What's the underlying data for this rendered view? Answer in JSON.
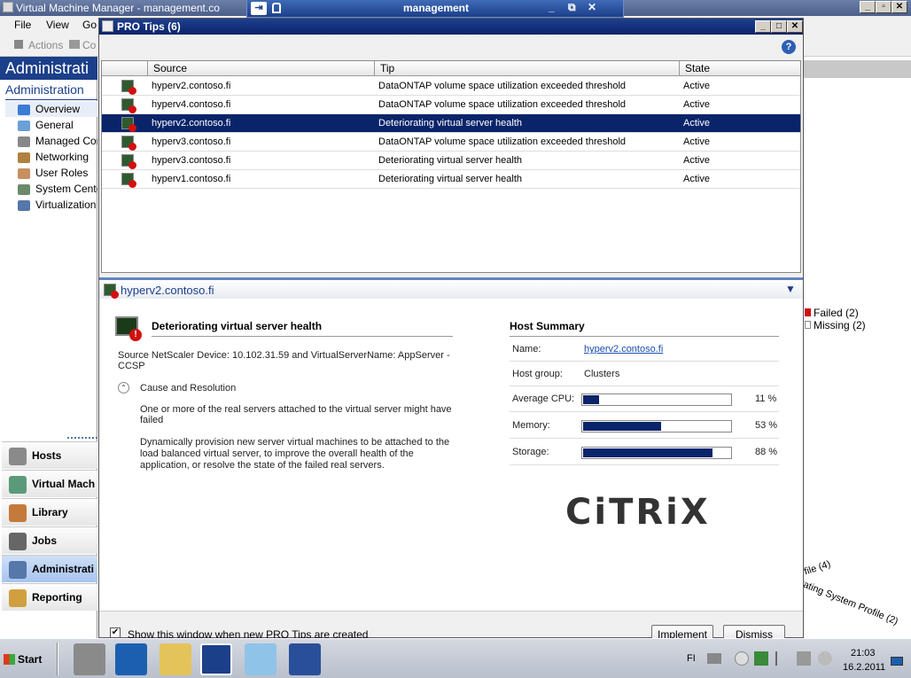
{
  "vmm": {
    "title": "Virtual Machine Manager - management.co",
    "menu": [
      "File",
      "View",
      "Go"
    ],
    "toolbar": {
      "actions": "Actions",
      "columns": "Co"
    },
    "left_header": "Administrati",
    "sub_title": "Administration",
    "tree": [
      {
        "label": "Overview",
        "icon": "overview-icon",
        "color": "#3a7bd5"
      },
      {
        "label": "General",
        "icon": "general-icon",
        "color": "#6a9fd8"
      },
      {
        "label": "Managed Cor",
        "icon": "managed-computers-icon",
        "color": "#888"
      },
      {
        "label": "Networking",
        "icon": "networking-icon",
        "color": "#b08040"
      },
      {
        "label": "User Roles",
        "icon": "user-roles-icon",
        "color": "#c89060"
      },
      {
        "label": "System Cente",
        "icon": "system-center-icon",
        "color": "#6a8a6a"
      },
      {
        "label": "Virtualization I",
        "icon": "virtualization-icon",
        "color": "#5577aa"
      }
    ],
    "nav": [
      {
        "label": "Hosts",
        "icon": "hosts-icon",
        "color": "#8a8a8a"
      },
      {
        "label": "Virtual Mach",
        "icon": "virtual-machines-icon",
        "color": "#5a9a7a"
      },
      {
        "label": "Library",
        "icon": "library-icon",
        "color": "#c47a3a"
      },
      {
        "label": "Jobs",
        "icon": "jobs-icon",
        "color": "#666"
      },
      {
        "label": "Administrati",
        "icon": "administration-icon",
        "color": "#5577aa"
      },
      {
        "label": "Reporting",
        "icon": "reporting-icon",
        "color": "#d0a040"
      }
    ],
    "right": {
      "failed": "Failed (2)",
      "missing": "Missing (2)",
      "os_profile": "erating System Profile (2)",
      "os_profile2": "file (4)"
    }
  },
  "remote_bar": {
    "title": "management"
  },
  "pro_tips": {
    "title": "PRO Tips (6)",
    "columns": [
      "Source",
      "Tip",
      "State"
    ],
    "rows": [
      {
        "source": "hyperv2.contoso.fi",
        "tip": "DataONTAP volume space utilization exceeded threshold",
        "state": "Active"
      },
      {
        "source": "hyperv4.contoso.fi",
        "tip": "DataONTAP volume space utilization exceeded threshold",
        "state": "Active"
      },
      {
        "source": "hyperv2.contoso.fi",
        "tip": "Deteriorating virtual server health",
        "state": "Active"
      },
      {
        "source": "hyperv3.contoso.fi",
        "tip": "DataONTAP volume space utilization exceeded threshold",
        "state": "Active"
      },
      {
        "source": "hyperv3.contoso.fi",
        "tip": "Deteriorating virtual server health",
        "state": "Active"
      },
      {
        "source": "hyperv1.contoso.fi",
        "tip": "Deteriorating virtual server health",
        "state": "Active"
      }
    ],
    "detail": {
      "host": "hyperv2.contoso.fi",
      "heading": "Deteriorating virtual server health",
      "source_line1": "Source NetScaler Device: 10.102.31.59 and VirtualServerName: AppServer -",
      "source_line2": "CCSP",
      "cause_label": "Cause and Resolution",
      "cause_text1": "One or more of the real servers attached to the virtual server might have",
      "cause_text2": "failed",
      "resolution1": "Dynamically provision new server virtual machines to be attached to the",
      "resolution2": "load balanced virtual server, to improve the overall health of the",
      "resolution3": "application, or resolve the state of the failed real servers.",
      "summary_title": "Host Summary",
      "name_label": "Name:",
      "name_value": "hyperv2.contoso.fi",
      "group_label": "Host group:",
      "group_value": "Clusters",
      "cpu_label": "Average CPU:",
      "cpu_value": "11 %",
      "cpu_pct": 11,
      "mem_label": "Memory:",
      "mem_value": "53 %",
      "mem_pct": 53,
      "storage_label": "Storage:",
      "storage_value": "88 %",
      "storage_pct": 88,
      "logo": "CiTRiX"
    },
    "footer": {
      "checkbox_label": "Show this window when new PRO Tips are created",
      "implement": "Implement",
      "dismiss": "Dismiss"
    }
  },
  "taskbar": {
    "start": "Start",
    "lang": "FI",
    "time": "21:03",
    "date": "16.2.2011"
  }
}
